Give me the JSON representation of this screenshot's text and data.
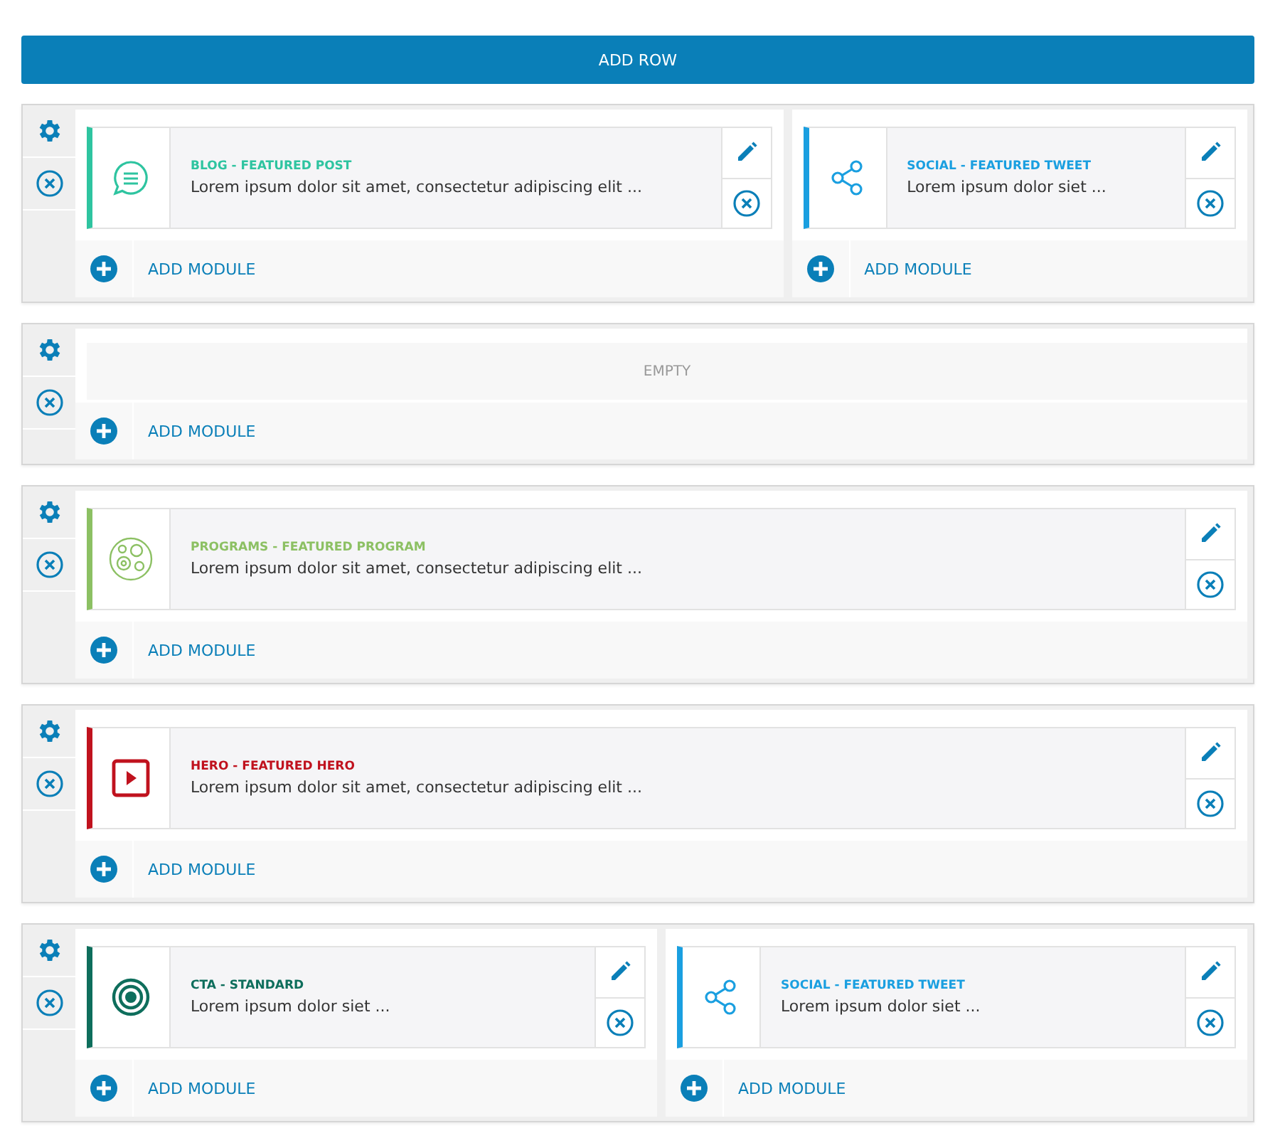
{
  "add_row_button": "ADD ROW",
  "rows": [
    {
      "columns": [
        {
          "modules": [
            {
              "kind": "chat",
              "color": "#2ec4a0",
              "title": "BLOG - FEATURED POST",
              "text": "Lorem ipsum dolor sit amet, consectetur adipiscing elit ..."
            }
          ],
          "add_label": "ADD MODULE"
        },
        {
          "modules": [
            {
              "kind": "share",
              "color": "#1a9fe0",
              "title": "SOCIAL - FEATURED TWEET",
              "text": "Lorem ipsum dolor siet ..."
            }
          ],
          "add_label": "ADD MODULE"
        }
      ]
    },
    {
      "columns": [
        {
          "empty_label": "EMPTY",
          "add_label": "ADD MODULE"
        }
      ]
    },
    {
      "columns": [
        {
          "modules": [
            {
              "kind": "programs",
              "color": "#8cc063",
              "title": "PROGRAMS - FEATURED PROGRAM",
              "text": "Lorem ipsum dolor sit amet, consectetur adipiscing elit ..."
            }
          ],
          "add_label": "ADD MODULE"
        }
      ]
    },
    {
      "columns": [
        {
          "modules": [
            {
              "kind": "play",
              "color": "#c0121e",
              "title": "HERO - FEATURED HERO",
              "text": "Lorem ipsum dolor sit amet, consectetur adipiscing elit ..."
            }
          ],
          "add_label": "ADD MODULE"
        }
      ]
    },
    {
      "columns": [
        {
          "modules": [
            {
              "kind": "target",
              "color": "#0e6e5c",
              "title": "CTA - STANDARD",
              "text": "Lorem ipsum dolor siet ..."
            }
          ],
          "add_label": "ADD MODULE"
        },
        {
          "modules": [
            {
              "kind": "share",
              "color": "#1a9fe0",
              "title": "SOCIAL - FEATURED TWEET",
              "text": "Lorem ipsum dolor siet ..."
            }
          ],
          "add_label": "ADD MODULE"
        }
      ]
    }
  ]
}
